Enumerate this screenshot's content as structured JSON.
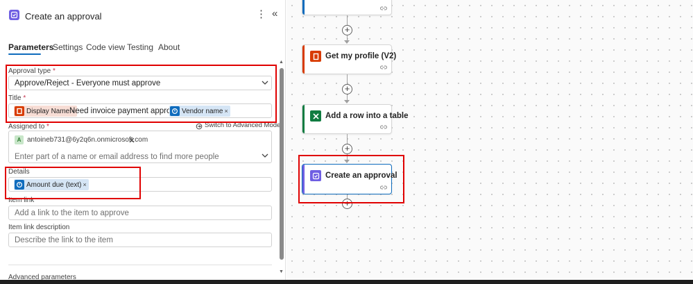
{
  "panel": {
    "title": "Create an approval",
    "more_glyph": "⋮",
    "collapse_glyph": "«",
    "tabs": [
      {
        "label": "Parameters",
        "active": true
      },
      {
        "label": "Settings",
        "active": false
      },
      {
        "label": "Code view",
        "active": false
      },
      {
        "label": "Testing",
        "active": false
      },
      {
        "label": "About",
        "active": false
      }
    ],
    "approval_type": {
      "label": "Approval type",
      "required": "*",
      "value": "Approve/Reject - Everyone must approve"
    },
    "title_field": {
      "label": "Title",
      "required": "*",
      "token1": {
        "text": "Display Name",
        "icon": "office-icon"
      },
      "middle_text": "Need invoice payment approval for",
      "token2": {
        "text": "Vendor name",
        "icon": "approval-icon"
      }
    },
    "assigned_to": {
      "label": "Assigned to",
      "required": "*",
      "advanced_link": "Switch to Advanced Mode",
      "person_initial": "A",
      "person_email": "antoineb731@6y2q6n.onmicrosoft.com",
      "placeholder": "Enter part of a name or email address to find more people"
    },
    "details": {
      "label": "Details",
      "token": {
        "text": "Amount due (text)",
        "icon": "approval-icon"
      }
    },
    "item_link": {
      "label": "Item link",
      "placeholder": "Add a link to the item to approve"
    },
    "item_link_description": {
      "label": "Item link description",
      "placeholder": "Describe the link to the item"
    },
    "advanced_parameters": "Advanced parameters",
    "token_remove_glyph": "×"
  },
  "canvas": {
    "nodes": [
      {
        "label": "",
        "icon": "",
        "accent": "#0f6cbd"
      },
      {
        "label": "Get my profile (V2)",
        "icon": "office-icon",
        "accent": "#d83b01"
      },
      {
        "label": "Add a row into a table",
        "icon": "excel-icon",
        "accent": "#107c41"
      },
      {
        "label": "Create an approval",
        "icon": "approval-icon",
        "accent": "#6f5fe2"
      }
    ],
    "plus_glyph": "+",
    "link_glyph": "⛓"
  },
  "colors": {
    "approval": "#6f5fe2",
    "office": "#d83b01",
    "excel": "#107c41",
    "highlight_box": "#e00000",
    "selected_node_border": "#0f6cbd"
  }
}
